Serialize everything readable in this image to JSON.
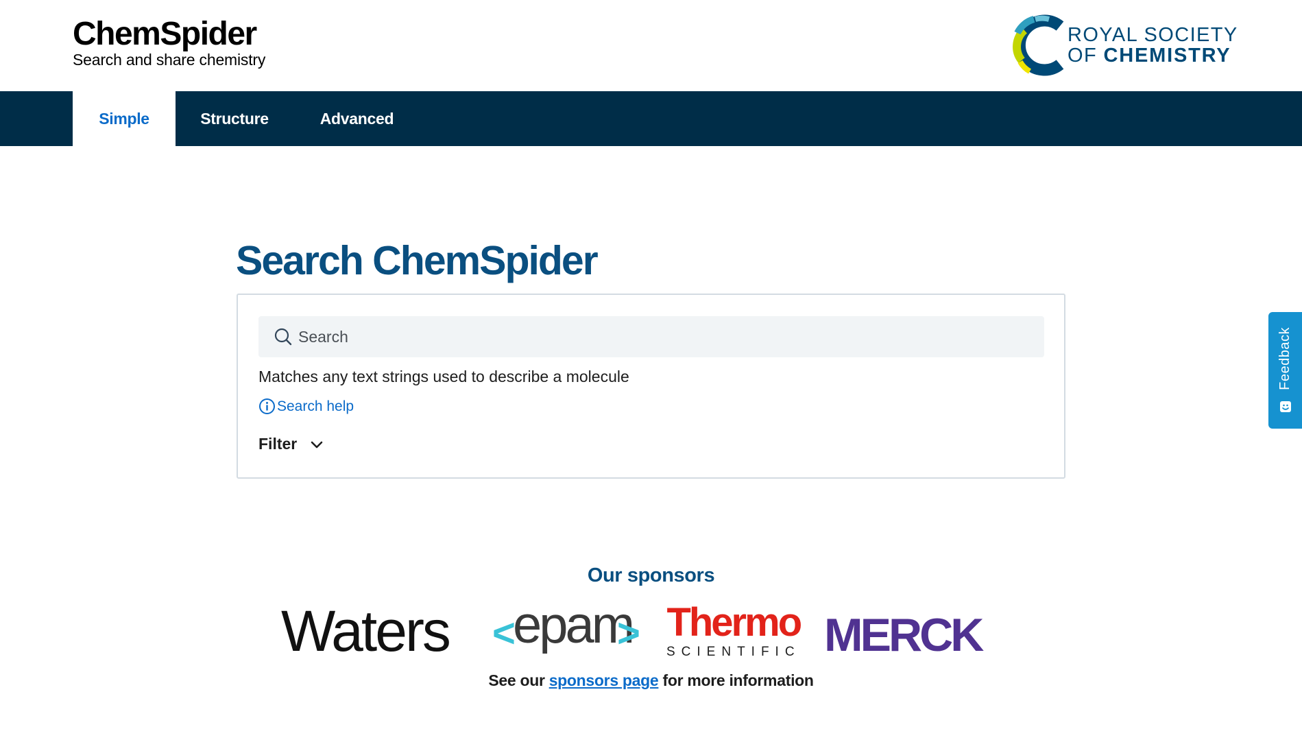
{
  "header": {
    "brand_title": "ChemSpider",
    "brand_tagline": "Search and share chemistry",
    "publisher_line1": "ROYAL SOCIETY",
    "publisher_of": "OF ",
    "publisher_chemistry": "CHEMISTRY"
  },
  "nav": {
    "tabs": [
      {
        "label": "Simple",
        "active": true
      },
      {
        "label": "Structure",
        "active": false
      },
      {
        "label": "Advanced",
        "active": false
      }
    ]
  },
  "main": {
    "title": "Search ChemSpider",
    "search_placeholder": "Search",
    "hint": "Matches any text strings used to describe a molecule",
    "help_label": "Search help",
    "filter_label": "Filter"
  },
  "feedback": {
    "label": "Feedback"
  },
  "sponsors": {
    "title": "Our sponsors",
    "logos": {
      "waters": "Waters",
      "epam": "epam",
      "epam_left": "<",
      "epam_right": ">",
      "thermo_main": "Thermo",
      "thermo_sub": "SCIENTIFIC",
      "merck": "MERCK"
    },
    "more_prefix": "See our ",
    "more_link": "sponsors page",
    "more_suffix": " for more information"
  },
  "colors": {
    "navbar": "#002d48",
    "brand_blue": "#0a4f80",
    "link_blue": "#0b6bc9",
    "feedback": "#1692d0",
    "thermo_red": "#e2231a",
    "merck_purple": "#503291",
    "epam_cyan": "#39c2d7"
  },
  "icons": {
    "search": "search-icon",
    "help": "info-icon",
    "filter": "chevron-down-icon",
    "feedback": "feedback-icon"
  }
}
